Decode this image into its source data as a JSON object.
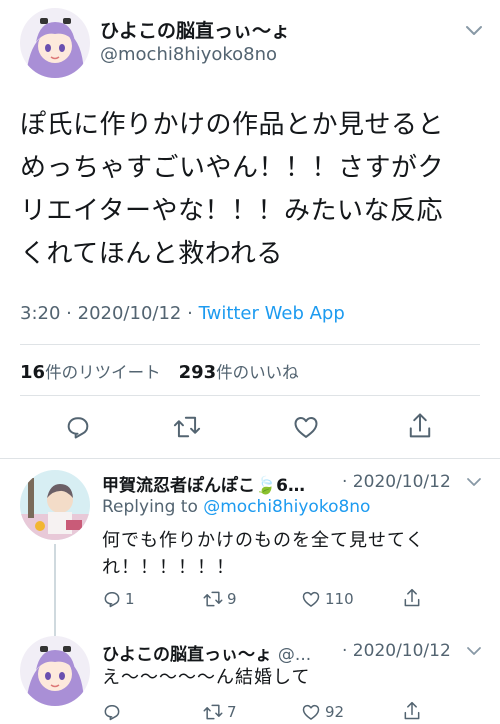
{
  "main_tweet": {
    "display_name": "ひよこの脳直っぃ〜ょ",
    "handle": "@mochi8hiyoko8no",
    "text_lines": [
      "ぽ氏に作りかけの作品とか見せると",
      "めっちゃすごいやん！！！さすがク",
      "リエイターやな！！！みたいな反応",
      "くれてほんと救われる"
    ],
    "time": "3:20",
    "date": "2020/10/12",
    "separator": "·",
    "source_app": "Twitter Web App",
    "retweet_count": "16",
    "retweet_label": "件のリツイート",
    "like_count": "293",
    "like_label": "件のいいね"
  },
  "replies": [
    {
      "display_name": "甲賀流忍者ぽんぽこ🍃6…",
      "date": "· 2020/10/12",
      "replying_prefix": "Replying to",
      "replying_to": "@mochi8hiyoko8no",
      "text_lines": [
        "何でも作りかけのものを全て見せてく",
        "れ！！！！！！"
      ],
      "reply_count": "1",
      "retweet_count": "9",
      "like_count": "110"
    },
    {
      "display_name": "ひよこの脳直っぃ〜ょ",
      "handle_truncated": "@...",
      "date": "· 2020/10/12",
      "text_lines": [
        "え〜〜〜〜〜ん結婚して"
      ],
      "reply_count": "",
      "retweet_count": "7",
      "like_count": "92"
    }
  ],
  "colors": {
    "accent": "#1d9bf0",
    "secondary_text": "#536471",
    "divider": "#dfe3e6"
  },
  "icons": [
    "reply-icon",
    "retweet-icon",
    "like-icon",
    "share-icon",
    "chevron-down-icon"
  ]
}
